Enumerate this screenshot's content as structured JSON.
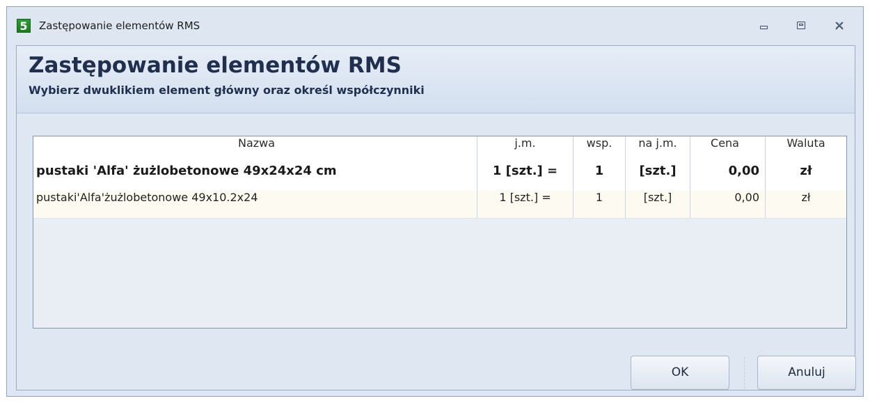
{
  "window": {
    "title": "Zastępowanie elementów RMS",
    "app_icon_glyph": "5",
    "controls": [
      "minimize-icon",
      "maximize-icon",
      "close-icon"
    ]
  },
  "header": {
    "title": "Zastępowanie elementów RMS",
    "subtitle": "Wybierz dwuklikiem element główny oraz określ współczynniki"
  },
  "table": {
    "columns": [
      "Nazwa",
      "j.m.",
      "wsp.",
      "na j.m.",
      "Cena",
      "Waluta"
    ],
    "rows": [
      {
        "nazwa": "pustaki 'Alfa' żużlobetonowe 49x24x24 cm",
        "jm": "1 [szt.] =",
        "wsp": "1",
        "na_jm": "[szt.]",
        "cena": "0,00",
        "waluta": "zł",
        "bold": true
      },
      {
        "nazwa": "pustaki'Alfa'żużlobetonowe 49x10.2x24",
        "jm": "1 [szt.] =",
        "wsp": "1",
        "na_jm": "[szt.]",
        "cena": "0,00",
        "waluta": "zł",
        "bold": false
      }
    ]
  },
  "buttons": {
    "ok": "OK",
    "cancel": "Anuluj"
  },
  "colors": {
    "window_bg": "#dde6f1",
    "header_text": "#1f2f4d",
    "grid_border": "#7f95b3",
    "alt_row_bg": "#fdfbf1"
  }
}
